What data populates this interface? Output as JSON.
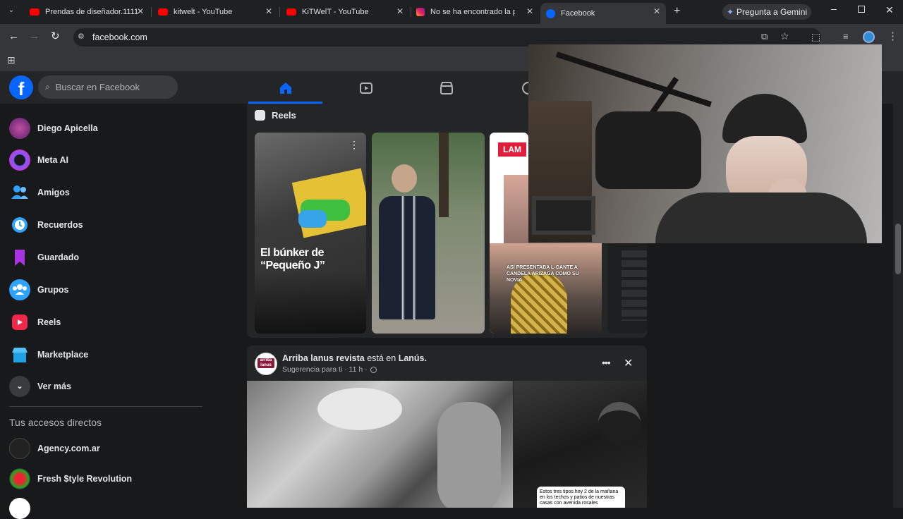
{
  "browser": {
    "tabs": [
      {
        "title": "Prendas de diseñador.1111",
        "favicon": "youtube-icon"
      },
      {
        "title": "kitwelt - YouTube",
        "favicon": "youtube-icon"
      },
      {
        "title": "KiTWelT - YouTube",
        "favicon": "youtube-icon"
      },
      {
        "title": "No se ha encontrado la pág",
        "favicon": "instagram-icon"
      },
      {
        "title": "Facebook",
        "favicon": "facebook-icon"
      }
    ],
    "gemini_label": "Pregunta a Gemini",
    "url": "facebook.com",
    "new_tab": "+"
  },
  "facebook": {
    "search_placeholder": "Buscar en Facebook",
    "sidebar": [
      {
        "label": "Diego Apicella",
        "icon": "avatar"
      },
      {
        "label": "Meta AI",
        "icon": "meta-ai-icon"
      },
      {
        "label": "Amigos",
        "icon": "friends-icon"
      },
      {
        "label": "Recuerdos",
        "icon": "memories-icon"
      },
      {
        "label": "Guardado",
        "icon": "saved-icon"
      },
      {
        "label": "Grupos",
        "icon": "groups-icon"
      },
      {
        "label": "Reels",
        "icon": "reels-icon"
      },
      {
        "label": "Marketplace",
        "icon": "marketplace-icon"
      },
      {
        "label": "Ver más",
        "icon": "chevron-down-icon"
      }
    ],
    "shortcuts_title": "Tus accesos directos",
    "shortcuts": [
      {
        "label": "Agency.com.ar"
      },
      {
        "label": "Fresh $tyle Revolution"
      }
    ],
    "reels": {
      "title": "Reels",
      "cards": [
        {
          "caption": "El búnker de “Pequeño J”"
        },
        {
          "caption": ""
        },
        {
          "caption": "ASÍ PRESENTABA L-GANTE A CANDELA ARIZAGA COMO SU NOVIA",
          "badge": "LAM"
        }
      ]
    },
    "post": {
      "author": "Arriba lanus revista",
      "is_in": "está en",
      "place": "Lanús.",
      "meta": "Sugerencia para ti · 11 h ·",
      "avatar_text": "arriba lanus",
      "image_caption": "Estos tres tipos hoy 2 de la mañana en los techos y patios de nuestras casas con avenida rosales"
    }
  },
  "colors": {
    "fb_blue": "#0866ff",
    "bg": "#18191a",
    "card": "#242526"
  }
}
